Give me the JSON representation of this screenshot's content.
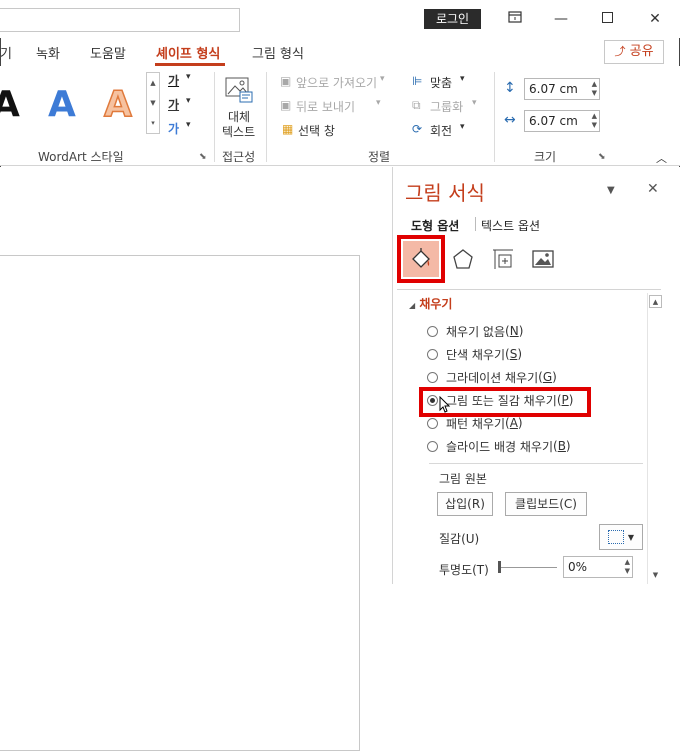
{
  "titlebar": {
    "login_label": "로그인"
  },
  "ribbon_tabs": [
    {
      "label": "기"
    },
    {
      "label": "녹화"
    },
    {
      "label": "도움말"
    },
    {
      "label": "셰이프 형식"
    },
    {
      "label": "그림 형식"
    }
  ],
  "share_label": "공유",
  "wordart": {
    "group_label": "WordArt 스타일",
    "text_fill_glyph": "가",
    "text_outline_glyph": "가",
    "text_effect_glyph": "가",
    "styles": [
      "A",
      "A",
      "A"
    ]
  },
  "accessibility": {
    "group_label": "접근성",
    "alt_text_line1": "대체",
    "alt_text_line2": "텍스트"
  },
  "arrange": {
    "group_label": "정렬",
    "bring_forward": "앞으로 가져오기",
    "send_backward": "뒤로 보내기",
    "selection_pane": "선택 창",
    "align": "맞춤",
    "group": "그룹화",
    "rotate": "회전"
  },
  "size": {
    "group_label": "크기",
    "height": "6.07 cm",
    "width": "6.07 cm"
  },
  "pane": {
    "title": "그림 서식",
    "shape_options_tab": "도형 옵션",
    "text_options_tab": "텍스트 옵션",
    "fill_section": "채우기",
    "fill_options": [
      {
        "label": "채우기 없음",
        "key": "N",
        "selected": false
      },
      {
        "label": "단색 채우기",
        "key": "S",
        "selected": false
      },
      {
        "label": "그라데이션 채우기",
        "key": "G",
        "selected": false
      },
      {
        "label": "그림 또는 질감 채우기",
        "key": "P",
        "selected": true
      },
      {
        "label": "패턴 채우기",
        "key": "A",
        "selected": false
      },
      {
        "label": "슬라이드 배경 채우기",
        "key": "B",
        "selected": false
      }
    ],
    "picture_source_label": "그림 원본",
    "insert_button": "삽입(R)",
    "clipboard_button": "클립보드(C)",
    "texture_label": "질감(U)",
    "transparency_label": "투명도(T)",
    "transparency_value": "0%"
  },
  "colors": {
    "accent": "#c43e1c",
    "highlight": "#e00000",
    "active_icon_bg": "#f4b9a6"
  }
}
